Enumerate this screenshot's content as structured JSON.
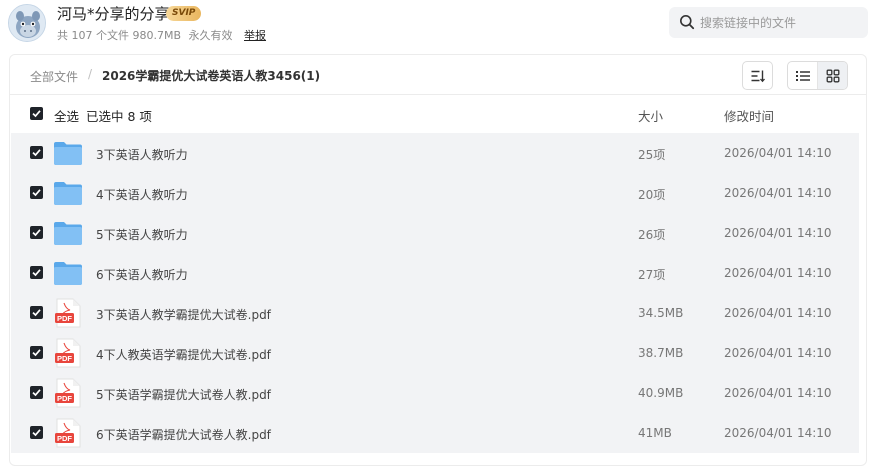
{
  "header": {
    "sharer_name": "河马*分享的分享",
    "vip_badge": "SVIP",
    "summary": "共 107 个文件 980.7MB",
    "validity": "永久有效",
    "report_label": "举报"
  },
  "search": {
    "placeholder": "搜索链接中的文件"
  },
  "breadcrumb": {
    "root": "全部文件",
    "separator": "/",
    "current": "2026学霸提优大试卷英语人教3456(1)"
  },
  "columns": {
    "select_all": "全选",
    "selected": "已选中  8  项",
    "size": "大小",
    "modified": "修改时间"
  },
  "files": [
    {
      "name": "3下英语人教听力",
      "size": "25项",
      "modified": "2026/04/01 14:10",
      "type": "folder",
      "checked": true
    },
    {
      "name": "4下英语人教听力",
      "size": "20项",
      "modified": "2026/04/01 14:10",
      "type": "folder",
      "checked": true
    },
    {
      "name": "5下英语人教听力",
      "size": "26项",
      "modified": "2026/04/01 14:10",
      "type": "folder",
      "checked": true
    },
    {
      "name": "6下英语人教听力",
      "size": "27项",
      "modified": "2026/04/01 14:10",
      "type": "folder",
      "checked": true
    },
    {
      "name": "3下英语人教学霸提优大试卷.pdf",
      "size": "34.5MB",
      "modified": "2026/04/01 14:10",
      "type": "pdf",
      "checked": true
    },
    {
      "name": "4下人教英语学霸提优大试卷.pdf",
      "size": "38.7MB",
      "modified": "2026/04/01 14:10",
      "type": "pdf",
      "checked": true
    },
    {
      "name": "5下英语学霸提优大试卷人教.pdf",
      "size": "40.9MB",
      "modified": "2026/04/01 14:10",
      "type": "pdf",
      "checked": true
    },
    {
      "name": "6下英语学霸提优大试卷人教.pdf",
      "size": "41MB",
      "modified": "2026/04/01 14:10",
      "type": "pdf",
      "checked": true
    }
  ],
  "icons": {
    "folder_icon": "folder-icon",
    "pdf_icon": "pdf-icon",
    "pdf_label": "PDF"
  },
  "colors": {
    "folder": "#6cb4ee",
    "pdf": "#e8453c",
    "checkbox": "#1f2329",
    "row_selected_bg": "#f2f3f5"
  }
}
